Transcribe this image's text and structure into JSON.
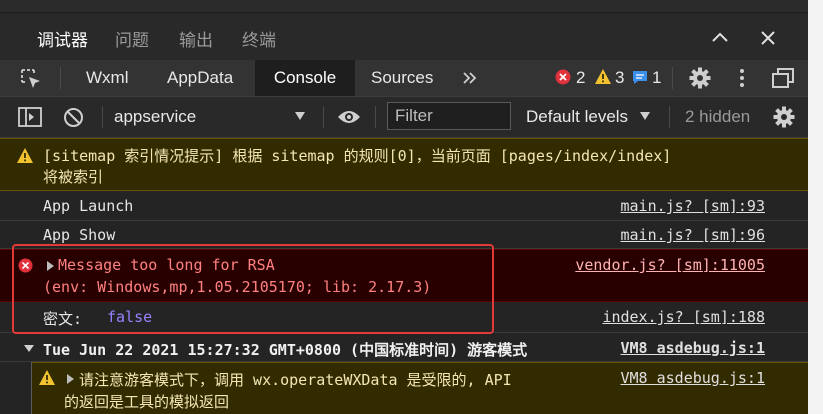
{
  "panel_tabs": [
    "调试器",
    "问题",
    "输出",
    "终端"
  ],
  "devtools_tabs": [
    "Wxml",
    "AppData",
    "Console",
    "Sources"
  ],
  "status_counts": {
    "errors": "2",
    "warnings": "3",
    "info": "1"
  },
  "toolbar": {
    "context": "appservice",
    "filter_placeholder": "Filter",
    "levels": "Default levels",
    "hidden": "2 hidden"
  },
  "console": {
    "sitemap_line1": "[sitemap 索引情况提示] 根据 sitemap 的规则[0]，当前页面 [pages/index/index]",
    "sitemap_line2": "将被索引",
    "launch_text": "App Launch",
    "launch_src": "main.js? [sm]:93",
    "show_text": "App Show",
    "show_src": "main.js? [sm]:96",
    "error_line1": "Message too long for RSA",
    "error_line2": "(env: Windows,mp,1.05.2105170; lib: 2.17.3)",
    "error_src": "vendor.js? [sm]:11005",
    "cipher_label": "密文:",
    "cipher_value": "false",
    "cipher_src": "index.js? [sm]:188",
    "group_header": "Tue Jun 22 2021 15:27:32 GMT+0800 (中国标准时间) 游客模式",
    "group_src": "VM8 asdebug.js:1",
    "guest_line1": "请注意游客模式下，调用 wx.operateWXData 是受限的, API",
    "guest_line2": "的返回是工具的模拟返回",
    "guest_src": "VM8 asdebug.js:1"
  },
  "colors": {
    "error": "#e0323c",
    "warning": "#f3c230",
    "info": "#3b8eea",
    "highlight_box": "#e23a3a"
  }
}
